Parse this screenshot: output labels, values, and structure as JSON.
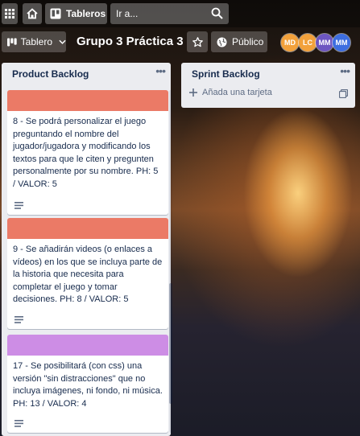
{
  "topbar": {
    "apps_icon": "grid-icon",
    "home_icon": "home-icon",
    "boards_label": "Tableros",
    "search_placeholder": "Ir a...",
    "search_icon": "magnifier-icon"
  },
  "boardbar": {
    "board_menu_label": "Tablero",
    "title": "Grupo 3 Práctica 3",
    "visibility_label": "Público",
    "members": [
      {
        "initials": "MD",
        "color": "#f2a13b"
      },
      {
        "initials": "LC",
        "color": "#f2a13b"
      },
      {
        "initials": "MM",
        "color": "#6d56c1"
      },
      {
        "initials": "MM",
        "color": "#3d6ee0"
      }
    ]
  },
  "lists": [
    {
      "title": "Product Backlog",
      "cards": [
        {
          "cover_color": "#eb7a66",
          "text": "8 - Se podrá personalizar el juego preguntando el nombre del jugador/jugadora y modificando los textos para que le citen y pregunten personalmente por su nombre. PH: 5 / VALOR: 5"
        },
        {
          "cover_color": "#eb7a66",
          "text": "9 - Se añadirán videos (o enlaces a vídeos) en los que se incluya parte de la historia que necesita para completar el juego y tomar decisiones. PH: 8 / VALOR: 5"
        },
        {
          "cover_color": "#cd8de5",
          "text": "17 - Se posibilitará (con css) una versión \"sin distracciones\" que no incluya imágenes, ni fondo, ni música. PH: 13 / VALOR: 4"
        }
      ]
    },
    {
      "title": "Sprint Backlog",
      "add_card_label": "Añada una tarjeta"
    }
  ]
}
